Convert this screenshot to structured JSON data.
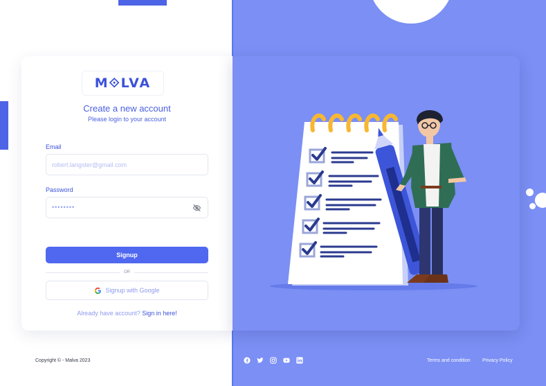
{
  "brand": {
    "logo_text": "M⟐LVA"
  },
  "form": {
    "title": "Create a new account",
    "subtitle": "Please login to your account",
    "email": {
      "label": "Email",
      "placeholder": "robert.langster@gmail.com"
    },
    "password": {
      "label": "Password",
      "masked_value": "••••••••",
      "visibility_icon": "eye-off-icon"
    },
    "signup_label": "Signup",
    "divider_text": "OR",
    "google_label": "Signup with Google",
    "already_text": "Already have account?",
    "signin_link": "Sign in here!"
  },
  "footer": {
    "copyright": "Copyright © - Malva 2023",
    "socials": [
      "facebook-icon",
      "twitter-icon",
      "instagram-icon",
      "youtube-icon",
      "linkedin-icon"
    ],
    "links": {
      "terms": "Terms and condition",
      "privacy": "Privacy Policy"
    }
  },
  "colors": {
    "accent": "#4e64e6",
    "button": "#5068f0",
    "panel": "#7b8ff4",
    "text_primary": "#3c52d9"
  }
}
